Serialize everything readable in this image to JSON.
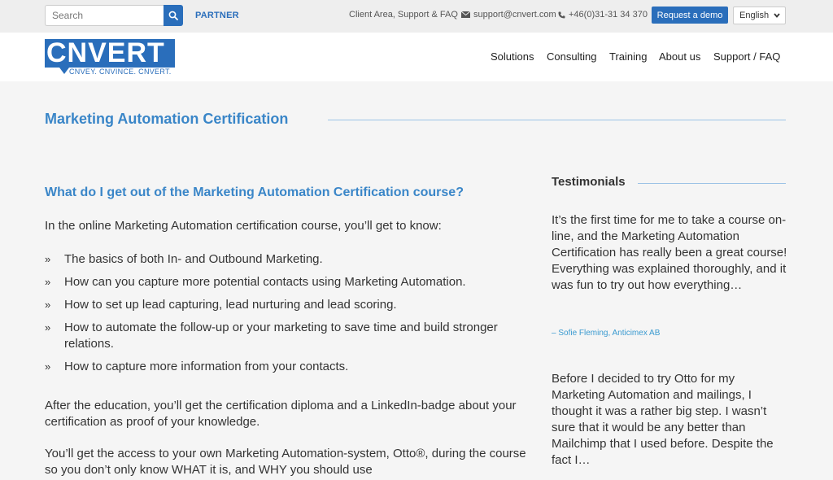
{
  "topbar": {
    "search_placeholder": "Search",
    "partner": "PARTNER",
    "client_area": "Client Area, Support & FAQ",
    "email": "support@cnvert.com",
    "phone": "+46(0)31-31 34 370",
    "demo_label": "Request a demo",
    "language": "English"
  },
  "header": {
    "logo_text": "CNVERT",
    "logo_tagline": "CNVEY. CNVINCE. CNVERT.",
    "nav": [
      "Solutions",
      "Consulting",
      "Training",
      "About us",
      "Support / FAQ"
    ]
  },
  "main": {
    "title": "Marketing Automation Certification",
    "subheading": "What do I get out of the Marketing Automation Certification course?",
    "intro": "In the online Marketing Automation certification course, you’ll get to know:",
    "bullet_mark": "»",
    "bullets": [
      "The basics of both In- and Outbound Marketing.",
      " How can you capture more potential contacts using Marketing Automation.",
      "How to set up lead capturing, lead nurturing and lead scoring.",
      "How to automate the follow-up or your marketing to save time and build stronger relations.",
      "How to capture more information from your contacts."
    ],
    "para1": "After the education, you’ll get the certification diploma and a LinkedIn-badge about your certification as proof of your knowledge.",
    "para2": "You’ll get the access to your own Marketing Automation-system, Otto®, during the course so you don’t only know WHAT it is, and WHY you should use"
  },
  "sidebar": {
    "heading": "Testimonials",
    "testimonials": [
      {
        "text": "It’s the first time for me to take a course on-line, and the Marketing Automation Certification has really been a great course! Everything was explained thoroughly, and it was fun to try out how everything…",
        "author": "– Sofie Fleming, Anticimex AB"
      },
      {
        "text": "Before I decided to try Otto for my Marketing Automation and mailings, I thought it was a rather big step. I wasn’t sure that it would be any better than Mailchimp that I used before. Despite the fact I…",
        "author": ""
      }
    ]
  },
  "colors": {
    "brand": "#2a6ebb",
    "accent_text": "#3a86c8",
    "author_link": "#3a9ad0"
  },
  "icons": {
    "search": "search-icon",
    "email": "envelope-icon",
    "phone": "phone-icon",
    "language": "chevron-down-icon"
  }
}
